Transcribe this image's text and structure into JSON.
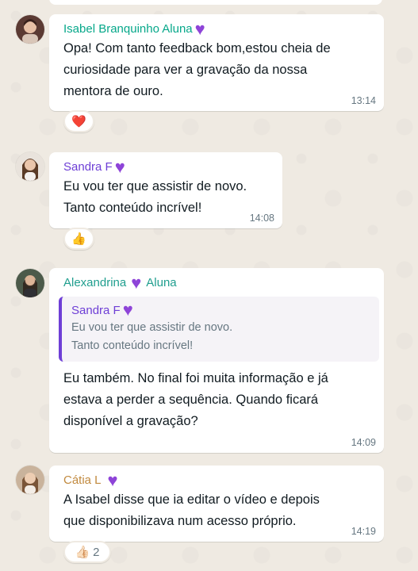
{
  "messages": [
    {
      "sender": "Isabel Branquinho Aluna",
      "sender_color": "#06a88a",
      "text": "Opa! Com tanto feedback bom,estou cheia de\ncuriosidade para ver a gravação da nossa\nmentora de ouro.",
      "time": "13:14",
      "reaction": "❤️"
    },
    {
      "sender": "Sandra F",
      "sender_color": "#6e3fd6",
      "text": "Eu vou ter que assistir de novo.\nTanto conteúdo incrível!",
      "time": "14:08",
      "reaction": "👍"
    },
    {
      "sender": "Alexandrina",
      "sender_suffix": "Aluna",
      "sender_color": "#1f9e8e",
      "quote": {
        "sender": "Sandra F",
        "text": "Eu vou ter que assistir de novo.\nTanto conteúdo incrível!"
      },
      "text": "Eu também. No final foi muita informação e já\nestava a perder a sequência. Quando ficará\ndisponível a gravação?",
      "time": "14:09"
    },
    {
      "sender": "Cátia L",
      "sender_color": "#c18a3f",
      "text": "A Isabel disse que ia editar o vídeo e depois\nque disponibilizava num acesso próprio.",
      "time": "14:19",
      "reaction": "👍🏻",
      "reaction_count": "2"
    }
  ],
  "heart_emoji": "💜",
  "icons": {
    "heart": "purple-heart-icon",
    "avatar": "avatar-photo"
  },
  "colors": {
    "background": "#efeae2",
    "bubble": "#ffffff",
    "meta": "#667781",
    "heart": "#8e44d8",
    "quote_bar": "#6e3fd6"
  }
}
